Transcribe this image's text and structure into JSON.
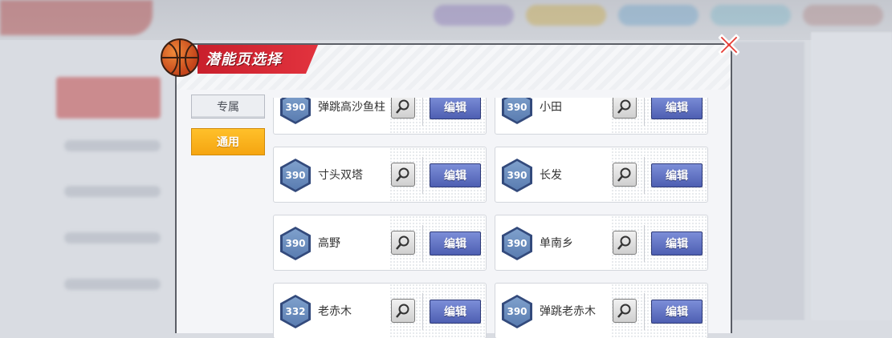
{
  "dialog": {
    "title": "潜能页选择"
  },
  "tabs": [
    {
      "label": "专属",
      "active": false
    },
    {
      "label": "通用",
      "active": true
    }
  ],
  "players": [
    {
      "rating": "390",
      "name": "弹跳高沙鱼柱",
      "edit_label": "编辑"
    },
    {
      "rating": "390",
      "name": "小田",
      "edit_label": "编辑"
    },
    {
      "rating": "390",
      "name": "寸头双塔",
      "edit_label": "编辑"
    },
    {
      "rating": "390",
      "name": "长发",
      "edit_label": "编辑"
    },
    {
      "rating": "390",
      "name": "高野",
      "edit_label": "编辑"
    },
    {
      "rating": "390",
      "name": "单南乡",
      "edit_label": "编辑"
    },
    {
      "rating": "332",
      "name": "老赤木",
      "edit_label": "编辑"
    },
    {
      "rating": "390",
      "name": "弹跳老赤木",
      "edit_label": "编辑"
    }
  ],
  "icons": {
    "close": "close-icon",
    "zoom": "magnifier-icon",
    "title": "basketball-icon"
  },
  "colors": {
    "title_banner": "#d7262f",
    "active_tab": "#f7ab16",
    "edit_button": "#5566be",
    "rating_hex": "#5a7db1"
  }
}
